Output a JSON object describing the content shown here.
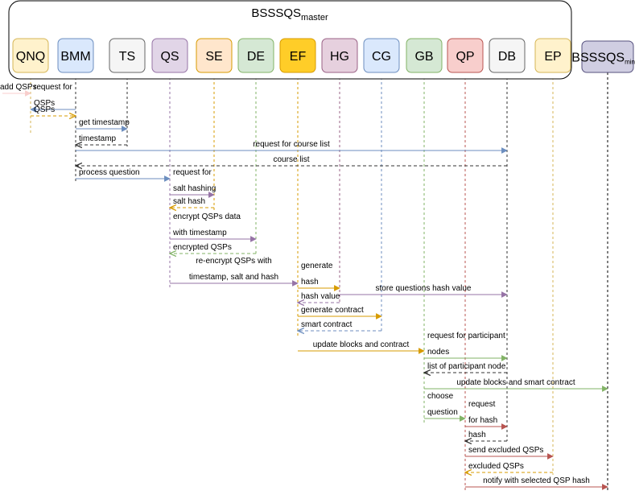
{
  "title": {
    "main": "BSSSQS",
    "sub": "master"
  },
  "minion": {
    "main": "BSSSQS",
    "sub": "minion"
  },
  "colors": {
    "blue": "#6c8ebf",
    "orange": "#d79b00",
    "purple": "#9673a6",
    "green": "#82b366",
    "red": "#b85450",
    "pink": "#f8cecc",
    "gray": "#333333",
    "frame": "#000000"
  },
  "participants": [
    {
      "id": "QNQ",
      "label": "QNQ",
      "fill": "#fff2cc",
      "stroke": "#d6b656",
      "line": "#d6b656"
    },
    {
      "id": "BMM",
      "label": "BMM",
      "fill": "#dae8fc",
      "stroke": "#6c8ebf",
      "line": "#333333"
    },
    {
      "id": "TS",
      "label": "TS",
      "fill": "#f5f5f5",
      "stroke": "#666666",
      "line": "#333333"
    },
    {
      "id": "QS",
      "label": "QS",
      "fill": "#e1d5e7",
      "stroke": "#9673a6",
      "line": "#9673a6"
    },
    {
      "id": "SE",
      "label": "SE",
      "fill": "#ffe6cc",
      "stroke": "#d79b00",
      "line": "#d79b00"
    },
    {
      "id": "DE",
      "label": "DE",
      "fill": "#d5e8d4",
      "stroke": "#82b366",
      "line": "#82b366"
    },
    {
      "id": "EF",
      "label": "EF",
      "fill": "#ffcd28",
      "stroke": "#d79b00",
      "line": "#d79b00"
    },
    {
      "id": "HG",
      "label": "HG",
      "fill": "#e6d0de",
      "stroke": "#996185",
      "line": "#996185"
    },
    {
      "id": "CG",
      "label": "CG",
      "fill": "#dae8fc",
      "stroke": "#6c8ebf",
      "line": "#6c8ebf"
    },
    {
      "id": "GB",
      "label": "GB",
      "fill": "#d5e8d4",
      "stroke": "#82b366",
      "line": "#82b366"
    },
    {
      "id": "QP",
      "label": "QP",
      "fill": "#f8cecc",
      "stroke": "#b85450",
      "line": "#b85450"
    },
    {
      "id": "DB",
      "label": "DB",
      "fill": "#f5f5f5",
      "stroke": "#666666",
      "line": "#333333"
    },
    {
      "id": "EP",
      "label": "EP",
      "fill": "#fff2cc",
      "stroke": "#d6b656",
      "line": "#d6b656"
    },
    {
      "id": "MIN",
      "label": "BSSSQS_minion",
      "fill": "#d0cee2",
      "stroke": "#56517e",
      "line": "#000000"
    }
  ],
  "messages": [
    {
      "from": "EXT",
      "to": "QNQ",
      "color": "pink",
      "dashed": false,
      "labels": [
        "add QSPs"
      ]
    },
    {
      "from": "BMM",
      "to": "QNQ",
      "color": "blue",
      "dashed": false,
      "labels": [
        "request for",
        "QSPs"
      ]
    },
    {
      "from": "QNQ",
      "to": "BMM",
      "color": "orange",
      "dashed": true,
      "labels": [
        "QSPs"
      ]
    },
    {
      "from": "BMM",
      "to": "TS",
      "color": "blue",
      "dashed": false,
      "labels": [
        "get timestamp"
      ]
    },
    {
      "from": "TS",
      "to": "BMM",
      "color": "gray",
      "dashed": true,
      "labels": [
        "timestamp"
      ]
    },
    {
      "from": "BMM",
      "to": "DB",
      "color": "blue",
      "dashed": false,
      "labels": [
        "request for course list"
      ]
    },
    {
      "from": "DB",
      "to": "BMM",
      "color": "gray",
      "dashed": true,
      "labels": [
        "course list"
      ]
    },
    {
      "from": "BMM",
      "to": "QS",
      "color": "blue",
      "dashed": false,
      "labels": [
        "process question"
      ]
    },
    {
      "from": "QS",
      "to": "SE",
      "color": "purple",
      "dashed": false,
      "labels": [
        "request for",
        "salt hashing"
      ]
    },
    {
      "from": "SE",
      "to": "QS",
      "color": "orange",
      "dashed": true,
      "labels": [
        "salt hash"
      ]
    },
    {
      "from": "QS",
      "to": "DE",
      "color": "purple",
      "dashed": false,
      "labels": [
        "encrypt QSPs data",
        "with timestamp"
      ]
    },
    {
      "from": "DE",
      "to": "QS",
      "color": "green",
      "dashed": true,
      "labels": [
        "encrypted QSPs"
      ]
    },
    {
      "from": "QS",
      "to": "EF",
      "color": "purple",
      "dashed": false,
      "labels": [
        "re-encrypt QSPs with",
        "timestamp, salt and hash"
      ]
    },
    {
      "from": "EF",
      "to": "HG",
      "color": "orange",
      "dashed": false,
      "labels": [
        "generate",
        "hash"
      ]
    },
    {
      "from": "HG",
      "to": "DB",
      "color": "purple",
      "dashed": false,
      "labels": [
        "store questions hash value"
      ]
    },
    {
      "from": "HG",
      "to": "EF",
      "color": "purple",
      "dashed": true,
      "labels": [
        "hash value"
      ]
    },
    {
      "from": "EF",
      "to": "CG",
      "color": "orange",
      "dashed": false,
      "labels": [
        "generate contract"
      ]
    },
    {
      "from": "CG",
      "to": "EF",
      "color": "blue",
      "dashed": true,
      "labels": [
        "smart contract"
      ]
    },
    {
      "from": "EF",
      "to": "GB",
      "color": "orange",
      "dashed": false,
      "labels": [
        "update blocks and contract"
      ]
    },
    {
      "from": "GB",
      "to": "DB",
      "color": "green",
      "dashed": false,
      "labels": [
        "request for participant",
        "nodes"
      ]
    },
    {
      "from": "DB",
      "to": "GB",
      "color": "gray",
      "dashed": true,
      "labels": [
        "list of participant node"
      ]
    },
    {
      "from": "GB",
      "to": "MIN",
      "color": "green",
      "dashed": false,
      "labels": [
        "update blocks and smart contract"
      ]
    },
    {
      "from": "GB",
      "to": "QP",
      "color": "green",
      "dashed": false,
      "labels": [
        "choose",
        "question"
      ]
    },
    {
      "from": "QP",
      "to": "DB",
      "color": "red",
      "dashed": false,
      "labels": [
        "request",
        "for hash"
      ]
    },
    {
      "from": "DB",
      "to": "QP",
      "color": "gray",
      "dashed": true,
      "labels": [
        "hash"
      ]
    },
    {
      "from": "QP",
      "to": "EP",
      "color": "red",
      "dashed": false,
      "labels": [
        "send excluded QSPs"
      ]
    },
    {
      "from": "EP",
      "to": "QP",
      "color": "orange",
      "dashed": true,
      "labels": [
        "excluded QSPs"
      ]
    },
    {
      "from": "QP",
      "to": "MIN",
      "color": "red",
      "dashed": false,
      "labels": [
        "notify with selected QSP hash"
      ]
    }
  ]
}
